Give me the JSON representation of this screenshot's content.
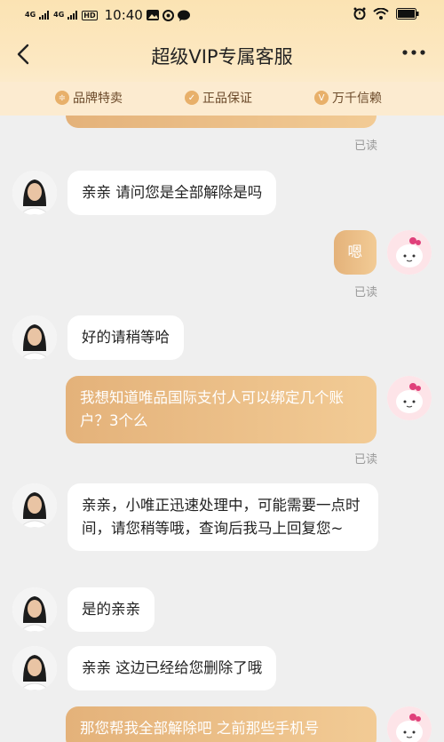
{
  "status_bar": {
    "net1": "4G",
    "net2": "4G",
    "hd": "HD",
    "time": "10:40"
  },
  "title": "超级VIP专属客服",
  "badges": [
    "品牌特卖",
    "正品保证",
    "万千信赖"
  ],
  "messages": [
    {
      "from": "user",
      "read_label": "已读"
    },
    {
      "from": "agent",
      "text": "亲亲 请问您是全部解除是吗"
    },
    {
      "from": "user",
      "text": "嗯",
      "read_label": "已读"
    },
    {
      "from": "agent",
      "text": "好的请稍等哈"
    },
    {
      "from": "user",
      "text": "我想知道唯品国际支付人可以绑定几个账户？3个么",
      "read_label": "已读"
    },
    {
      "from": "agent",
      "text": "亲亲，小唯正迅速处理中，可能需要一点时间，请您稍等哦，查询后我马上回复您~"
    },
    {
      "from": "agent",
      "text": "是的亲亲"
    },
    {
      "from": "agent",
      "text": "亲亲 这边已经给您删除了哦"
    },
    {
      "from": "user",
      "text": "那您帮我全部解除吧 之前那些手机号"
    }
  ],
  "colors": {
    "header": "#fbe3b3",
    "user_bubble": "#e8b47d",
    "agent_bubble": "#ffffff",
    "background": "#efefef"
  }
}
